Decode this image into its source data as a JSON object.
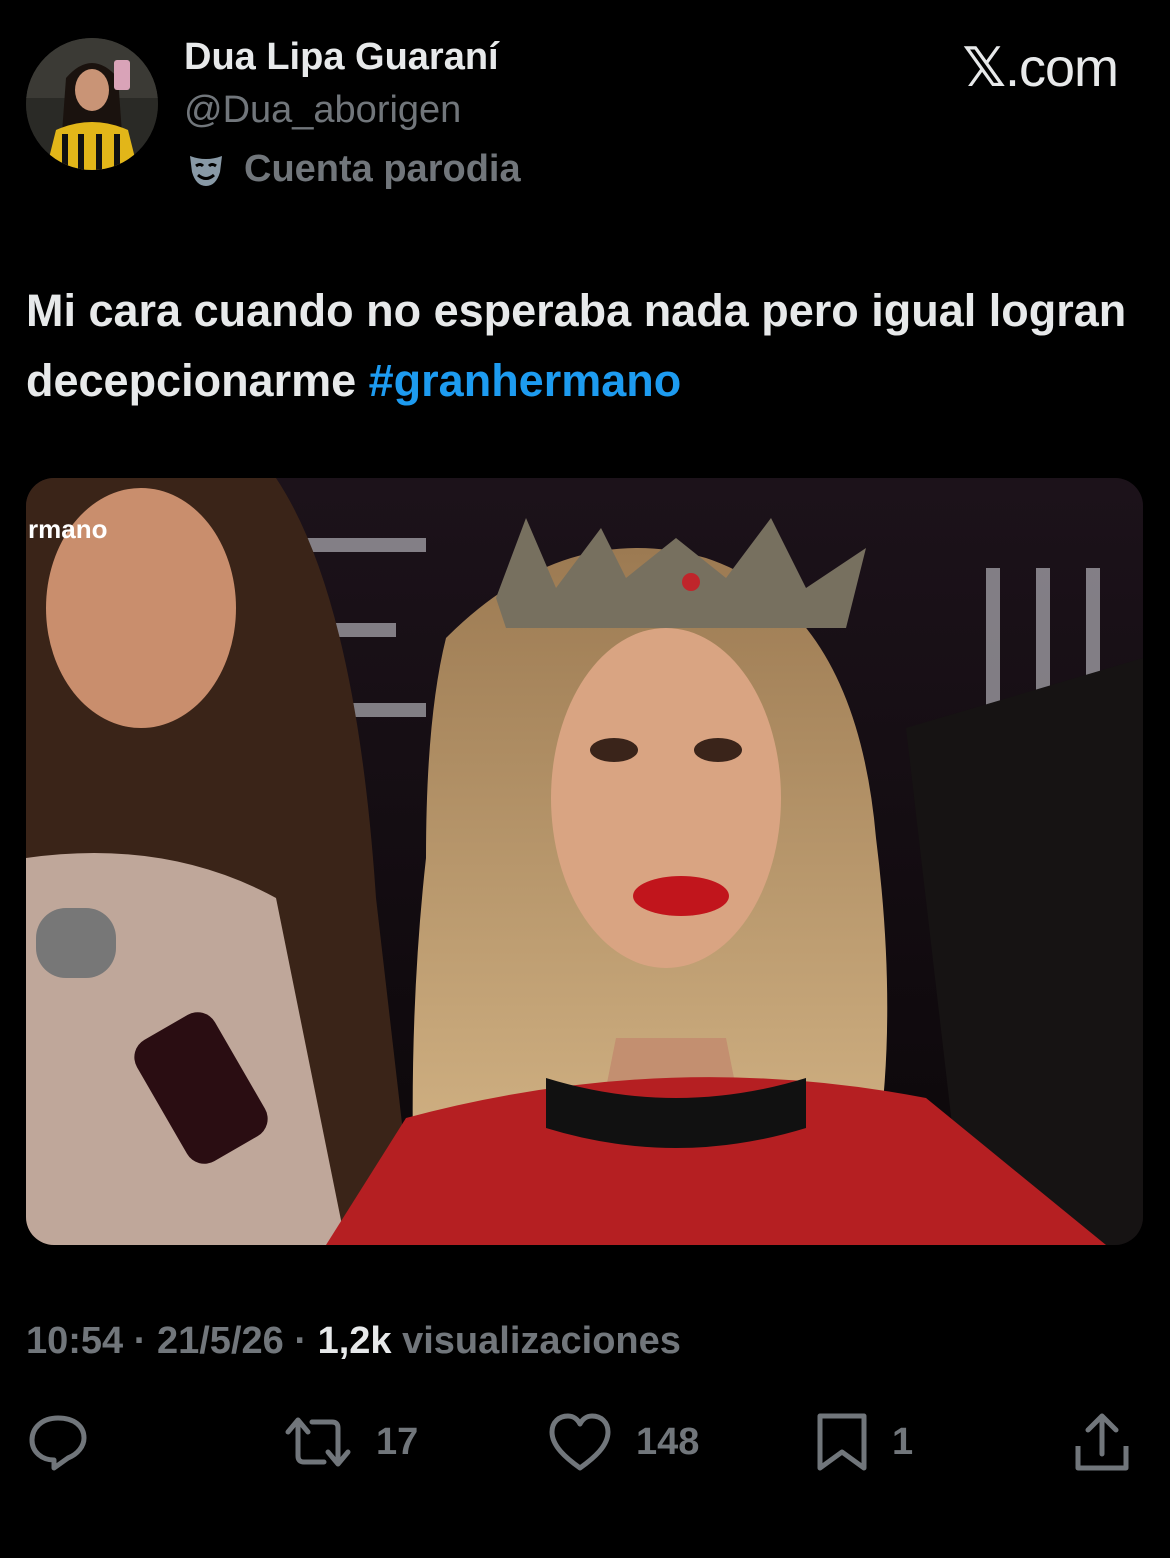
{
  "author": {
    "name": "Dua Lipa Guaraní",
    "handle": "@Dua_aborigen",
    "label": "Cuenta parodia"
  },
  "brand": {
    "mark": "𝕏",
    "suffix": ".com"
  },
  "tweet": {
    "text": "Mi cara cuando no esperaba nada pero igual logran decepcionarme ",
    "hashtag": "#granhermano"
  },
  "media": {
    "overlay_text": "rmano"
  },
  "meta": {
    "time": "10:54",
    "separator": "·",
    "date": "21/5/26",
    "views_count": "1,2k",
    "views_label": "visualizaciones"
  },
  "actions": {
    "retweets": "17",
    "likes": "148",
    "bookmarks": "1"
  },
  "colors": {
    "background": "#000000",
    "text_primary": "#e7e9ea",
    "text_secondary": "#71767b",
    "link": "#1d9bf0"
  }
}
